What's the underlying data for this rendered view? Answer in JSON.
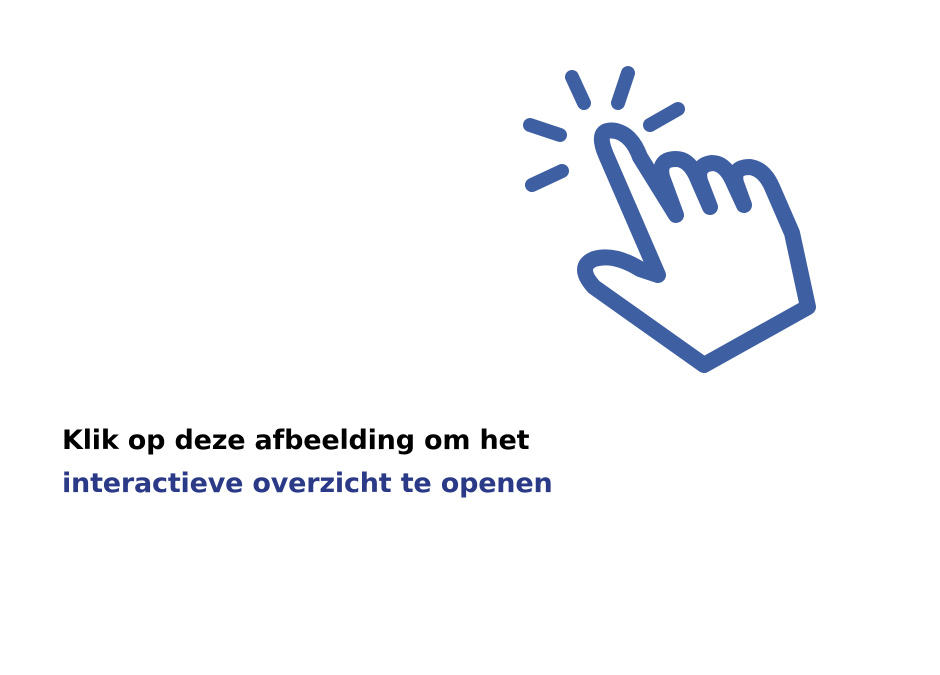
{
  "caption": {
    "line1": "Klik op deze afbeelding om het",
    "line2": "interactieve overzicht te openen"
  },
  "icon": {
    "name": "click-hand-icon"
  },
  "colors": {
    "background": "#ffffff",
    "icon": "#3f5fa3",
    "line1_text": "#000000",
    "line2_text": "#2b3a86"
  }
}
